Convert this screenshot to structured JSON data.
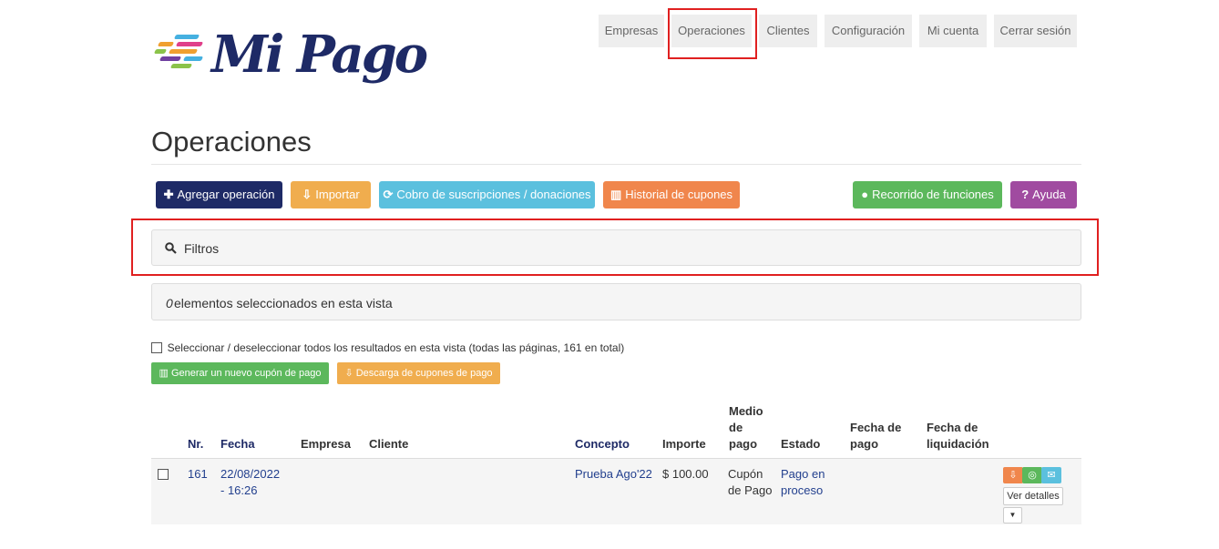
{
  "logo": {
    "text": "Mi Pago",
    "stripe_colors": [
      "#f0a030",
      "#45b0e0",
      "#e0408a",
      "#8bc34a",
      "#7040a0"
    ]
  },
  "nav": [
    {
      "label": "Empresas"
    },
    {
      "label": "Operaciones"
    },
    {
      "label": "Clientes"
    },
    {
      "label": "Configuración"
    },
    {
      "label": "Mi cuenta"
    },
    {
      "label": "Cerrar sesión"
    }
  ],
  "page_title": "Operaciones",
  "toolbar": {
    "add": "Agregar operación",
    "import": "Importar",
    "subscriptions": "Cobro de suscripciones / donaciones",
    "coupon_history": "Historial de cupones",
    "tour": "Recorrido de funciones",
    "help": "Ayuda"
  },
  "filters": {
    "label": "Filtros"
  },
  "selection": {
    "count": "0",
    "text": "elementos seleccionados en esta vista"
  },
  "select_all": {
    "label": "Seleccionar / deseleccionar todos los resultados en esta vista (todas las páginas, 161 en total)"
  },
  "actions": {
    "generate": "Generar un nuevo cupón de pago",
    "download": "Descarga de cupones de pago"
  },
  "table": {
    "headers": {
      "nr": "Nr.",
      "fecha": "Fecha",
      "empresa": "Empresa",
      "cliente": "Cliente",
      "concepto": "Concepto",
      "importe": "Importe",
      "medio_1": "Medio",
      "medio_2": "de",
      "medio_3": "pago",
      "estado": "Estado",
      "fecha_pago_1": "Fecha de",
      "fecha_pago_2": "pago",
      "fecha_liq_1": "Fecha de",
      "fecha_liq_2": "liquidación"
    },
    "rows": [
      {
        "nr": "161",
        "fecha_1": "22/08/2022",
        "fecha_2": "- 16:26",
        "empresa": "",
        "cliente": "",
        "concepto": "Prueba Ago'22",
        "importe": "$ 100.00",
        "medio_1": "Cupón",
        "medio_2": "de Pago",
        "estado_1": "Pago en",
        "estado_2": "proceso",
        "details": "Ver detalles"
      }
    ]
  },
  "colors": {
    "primary": "#1e2a66",
    "warning": "#f0ad4e",
    "info": "#5bc0de",
    "orange": "#f0864c",
    "success": "#5cb85c",
    "purple": "#a04ba0"
  }
}
